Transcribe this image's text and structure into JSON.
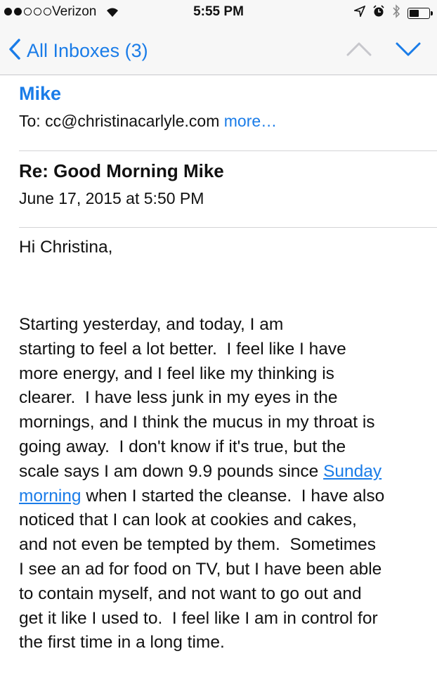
{
  "status_bar": {
    "carrier": "Verizon",
    "time": "5:55 PM",
    "signal_bars_filled": 2,
    "signal_bars_total": 5,
    "battery_level": 0.55
  },
  "nav": {
    "back_label": "All Inboxes (3)",
    "accent_color": "#1a7ce8"
  },
  "email": {
    "sender": "Mike",
    "to_prefix": "To:",
    "to_address": "cc@christinacarlyle.com",
    "more_label": "more…",
    "subject": "Re: Good Morning Mike",
    "date": "June 17, 2015 at 5:50 PM",
    "greeting": "Hi Christina,",
    "body_lines": [
      "Starting yesterday, and today, I am",
      "starting to feel a lot better.  I feel like I have",
      "more energy, and I feel like my thinking is",
      "clearer.  I have less junk in my eyes in the",
      "mornings, and I think the mucus in my throat is",
      "going away.  I don't know if it's true, but the",
      "scale says I am down 9.9 pounds since",
      "Sunday",
      "morning",
      " when I started the cleanse.  I have also",
      "noticed that I can look at cookies and cakes,",
      "and not even be tempted by them.  Sometimes",
      "I see an ad for food on TV, but I have been able",
      "to contain myself, and not want to go out and",
      "get it like I used to.  I feel like I am in control for",
      "the first time in a long time."
    ]
  }
}
